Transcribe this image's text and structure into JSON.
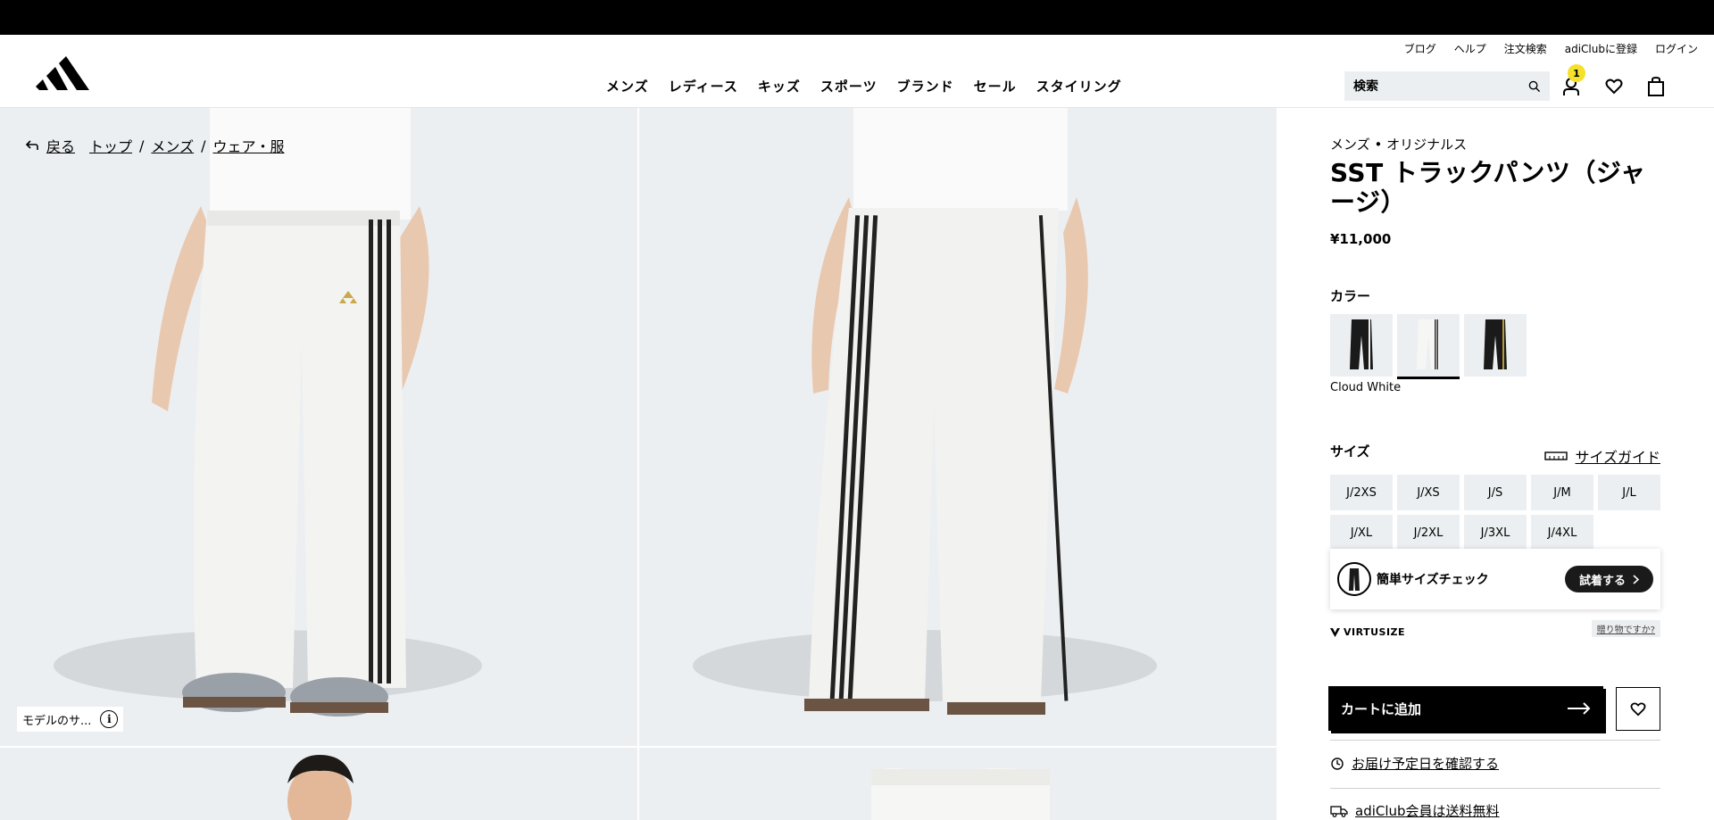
{
  "header": {
    "util_links": [
      "ブログ",
      "ヘルプ",
      "注文検索",
      "adiClubに登録",
      "ログイン"
    ],
    "nav": [
      "メンズ",
      "レディース",
      "キッズ",
      "スポーツ",
      "ブランド",
      "セール",
      "スタイリング"
    ],
    "search_placeholder": "検索",
    "badge_count": "1"
  },
  "breadcrumb": {
    "back": "戻る",
    "items": [
      "トップ",
      "メンズ",
      "ウェア・服"
    ],
    "sep": "/"
  },
  "gallery": {
    "model_chip": "モデルのサ...",
    "info_glyph": "i"
  },
  "product": {
    "category": "メンズ • オリジナルス",
    "title": "SST トラックパンツ（ジャージ）",
    "price": "¥11,000",
    "color_label": "カラー",
    "selected_color": "Cloud White",
    "size_label": "サイズ",
    "size_guide": "サイズガイド",
    "sizes": [
      "J/2XS",
      "J/XS",
      "J/S",
      "J/M",
      "J/L",
      "J/XL",
      "J/2XL",
      "J/3XL",
      "J/4XL"
    ],
    "virtusize_text": "簡単サイズチェック",
    "try_on": "試着する",
    "gift_link": "贈り物ですか?",
    "virtusize_brand": "VIRTUSIZE",
    "add_to_cart": "カートに追加",
    "delivery_link": "お届け予定日を確認する",
    "shipping_link": "adiClub会員は送料無料"
  },
  "colors": {
    "bg_photo": "#eceff1",
    "badge": "#f5e12a"
  }
}
